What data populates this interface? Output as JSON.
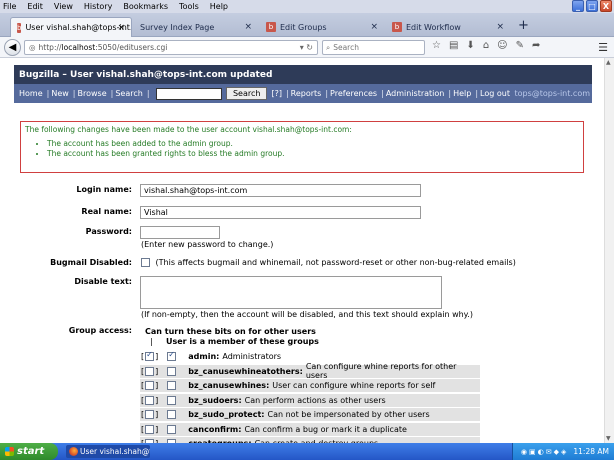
{
  "menubar": {
    "items": [
      "File",
      "Edit",
      "View",
      "History",
      "Bookmarks",
      "Tools",
      "Help"
    ]
  },
  "window_controls": {
    "minimize": "_",
    "maximize": "□",
    "close": "X"
  },
  "tabs": [
    {
      "title": "User vishal.shah@tops-int.co...",
      "active": true
    },
    {
      "title": "Survey Index Page",
      "active": false
    },
    {
      "title": "Edit Groups",
      "active": false
    },
    {
      "title": "Edit Workflow",
      "active": false
    }
  ],
  "tab_close": "×",
  "new_tab": "+",
  "navbar": {
    "url_prefix": "http://",
    "url_host": "localhost",
    "url_rest": ":5050/editusers.cgi",
    "search_placeholder": "Search",
    "icons": [
      "star-icon",
      "clipboard-icon",
      "download-icon",
      "home-icon",
      "chat-icon",
      "edit-icon",
      "share-icon"
    ]
  },
  "bugzilla": {
    "title": "Bugzilla – User vishal.shah@tops-int.com updated",
    "links": {
      "home": "Home",
      "new": "New",
      "browse": "Browse",
      "search": "Search",
      "search_button": "Search",
      "help_mark": "[?]",
      "reports": "Reports",
      "preferences": "Preferences",
      "administration": "Administration",
      "help": "Help",
      "logout": "Log out",
      "logged_user": "tops@tops-int.com"
    }
  },
  "message": {
    "intro": "The following changes have been made to the user account vishal.shah@tops-int.com:",
    "items": [
      "The account has been added to the admin group.",
      "The account has been granted rights to bless the admin group."
    ]
  },
  "form": {
    "login_label": "Login name:",
    "login_value": "vishal.shah@tops-int.com",
    "realname_label": "Real name:",
    "realname_value": "Vishal",
    "password_label": "Password:",
    "password_note": "(Enter new password to change.)",
    "bugmail_label": "Bugmail Disabled:",
    "bugmail_note": "(This affects bugmail and whinemail, not password-reset or other non-bug-related emails)",
    "disable_label": "Disable text:",
    "disable_note": "(If non-empty, then the account will be disabled, and this text should explain why.)",
    "group_label": "Group access:",
    "group_head1": "Can turn these bits on for other users",
    "group_head2": "User is a member of these groups",
    "groups": [
      {
        "name": "admin:",
        "desc": "Administrators",
        "bless": true,
        "member": true
      },
      {
        "name": "bz_canusewhineatothers:",
        "desc": "Can configure whine reports for other users",
        "bless": false,
        "member": false
      },
      {
        "name": "bz_canusewhines:",
        "desc": "User can configure whine reports for self",
        "bless": false,
        "member": false
      },
      {
        "name": "bz_sudoers:",
        "desc": "Can perform actions as other users",
        "bless": false,
        "member": false
      },
      {
        "name": "bz_sudo_protect:",
        "desc": "Can not be impersonated by other users",
        "bless": false,
        "member": false
      },
      {
        "name": "canconfirm:",
        "desc": "Can confirm a bug or mark it a duplicate",
        "bless": false,
        "member": false
      },
      {
        "name": "creategroups:",
        "desc": "Can create and destroy groups",
        "bless": false,
        "member": false
      }
    ]
  },
  "taskbar": {
    "start": "start",
    "task": "User vishal.shah@to...",
    "clock": "11:28 AM"
  }
}
